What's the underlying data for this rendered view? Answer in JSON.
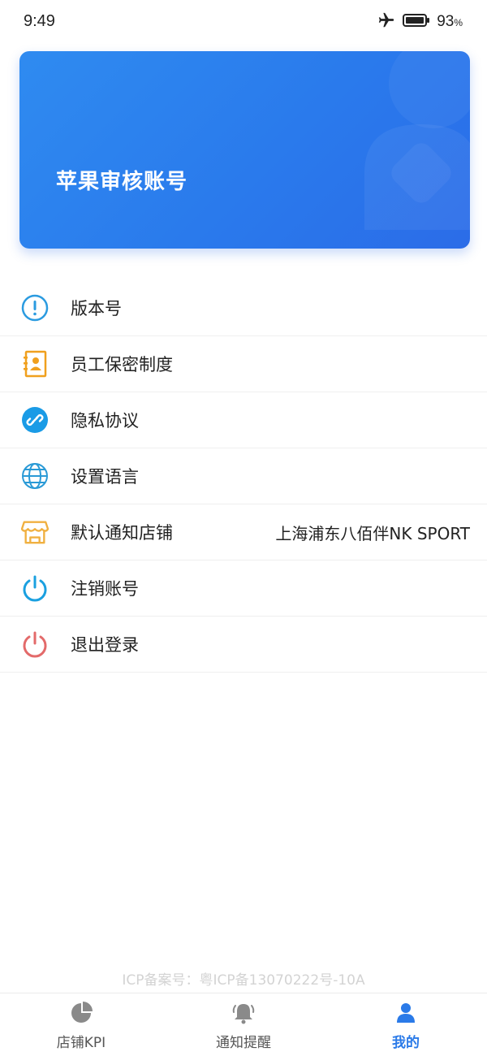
{
  "status_bar": {
    "time": "9:49",
    "battery_percent": "93",
    "battery_unit": "%",
    "icons": [
      "airplane-icon",
      "battery-icon"
    ]
  },
  "profile": {
    "name": "苹果审核账号",
    "card_colors": [
      "#2f8bf0",
      "#2b6ce8"
    ]
  },
  "menu": {
    "items": [
      {
        "label": "版本号",
        "icon": "info-icon",
        "color": "#2b9be0"
      },
      {
        "label": "员工保密制度",
        "icon": "contact-book-icon",
        "color": "#f0a01e"
      },
      {
        "label": "隐私协议",
        "icon": "link-icon",
        "color": "#1a9be6"
      },
      {
        "label": "设置语言",
        "icon": "globe-icon",
        "color": "#2a9ad6"
      },
      {
        "label": "默认通知店铺",
        "icon": "store-icon",
        "color": "#f0b040",
        "value": "上海浦东八佰伴NK SPORT"
      },
      {
        "label": "注销账号",
        "icon": "power-icon",
        "color": "#1aa0e0"
      },
      {
        "label": "退出登录",
        "icon": "power-icon",
        "color": "#e36a6a"
      }
    ]
  },
  "footer": {
    "icp": "ICP备案号：粤ICP备13070222号-10A"
  },
  "tabbar": {
    "tabs": [
      {
        "label": "店铺KPI",
        "icon": "pie-chart-icon",
        "active": false
      },
      {
        "label": "通知提醒",
        "icon": "bell-icon",
        "active": false
      },
      {
        "label": "我的",
        "icon": "user-icon",
        "active": true
      }
    ],
    "active_color": "#2a7ae8"
  }
}
